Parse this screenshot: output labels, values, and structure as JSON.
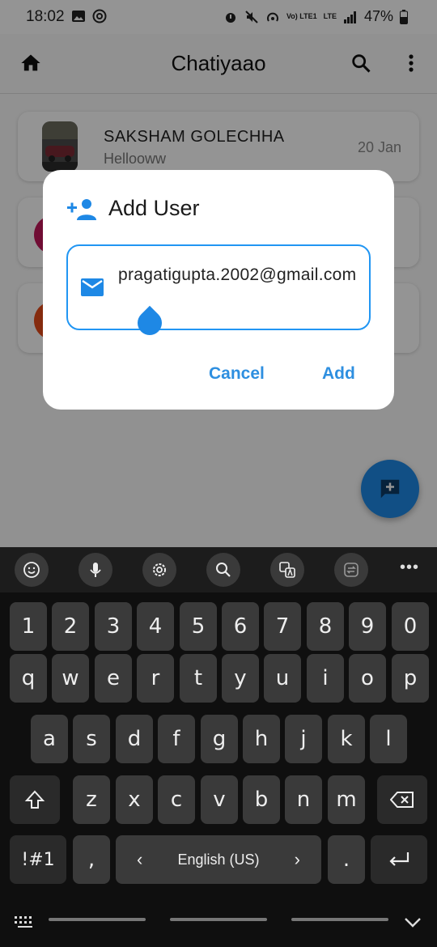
{
  "status_bar": {
    "time": "18:02",
    "battery": "47%",
    "network": "LTE",
    "volte": "Vo) LTE1"
  },
  "app_bar": {
    "title": "Chatiyaao"
  },
  "chats": [
    {
      "name": "SAKSHAM GOLECHHA",
      "last_message": "Hellooww",
      "date": "20 Jan"
    }
  ],
  "dialog": {
    "title": "Add User",
    "email_value": "pragatigupta.2002@gmail.com",
    "cancel_label": "Cancel",
    "add_label": "Add"
  },
  "keyboard": {
    "number_row": [
      "1",
      "2",
      "3",
      "4",
      "5",
      "6",
      "7",
      "8",
      "9",
      "0"
    ],
    "row1": [
      "q",
      "w",
      "e",
      "r",
      "t",
      "y",
      "u",
      "i",
      "o",
      "p"
    ],
    "row2": [
      "a",
      "s",
      "d",
      "f",
      "g",
      "h",
      "j",
      "k",
      "l"
    ],
    "row3": [
      "z",
      "x",
      "c",
      "v",
      "b",
      "n",
      "m"
    ],
    "symbols_label": "!#1",
    "comma": ",",
    "period": ".",
    "language_label": "English (US)",
    "lang_left": "‹",
    "lang_right": "›"
  },
  "colors": {
    "accent": "#1e88e5",
    "keyboard_bg": "#0f0f0f",
    "key_bg": "#3a3a3a"
  }
}
